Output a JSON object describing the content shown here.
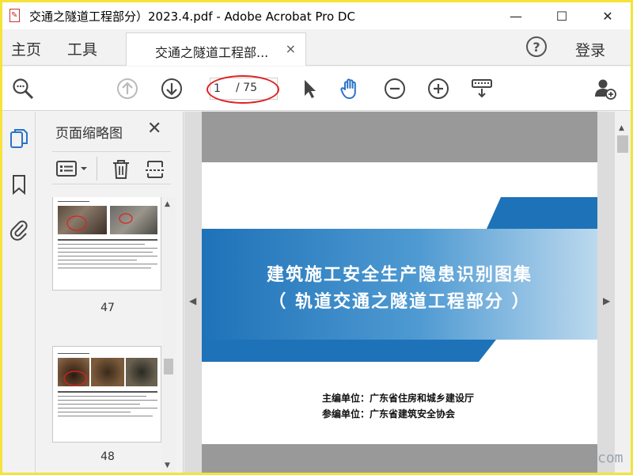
{
  "window": {
    "title": "交通之隧道工程部分）2023.4.pdf - Adobe Acrobat Pro DC",
    "minimize": "—",
    "maximize": "☐",
    "close": "✕"
  },
  "menu": {
    "home": "主页",
    "tools": "工具",
    "doc_tab": "交通之隧道工程部...",
    "tab_close": "×",
    "help": "?",
    "login": "登录"
  },
  "toolbar": {
    "current_page": "1",
    "total_pages": "/ 75",
    "icons": [
      "search-zoom-icon",
      "page-up-icon",
      "page-down-icon",
      "select-arrow-icon",
      "hand-tool-icon",
      "zoom-out-icon",
      "zoom-in-icon",
      "keyboard-tool-icon",
      "share-user-icon"
    ],
    "accent": "#2a73c8",
    "highlight": "#e02020"
  },
  "left_rail": {
    "icons": [
      "pages-icon",
      "bookmark-icon",
      "attachment-icon"
    ]
  },
  "thumbnail_pane": {
    "title": "页面缩略图",
    "close": "✕",
    "thumbs": [
      {
        "page": "47"
      },
      {
        "page": "48"
      }
    ]
  },
  "document": {
    "title_line1": "建筑施工安全生产隐患识别图集",
    "title_line2": "（ 轨道交通之隧道工程部分 ）",
    "editor": "主编单位：广东省住房和城乡建设厅",
    "co_editor": "参编单位：广东省建筑安全协会",
    "banner_color": "#1e72b8"
  },
  "watermark": "com"
}
